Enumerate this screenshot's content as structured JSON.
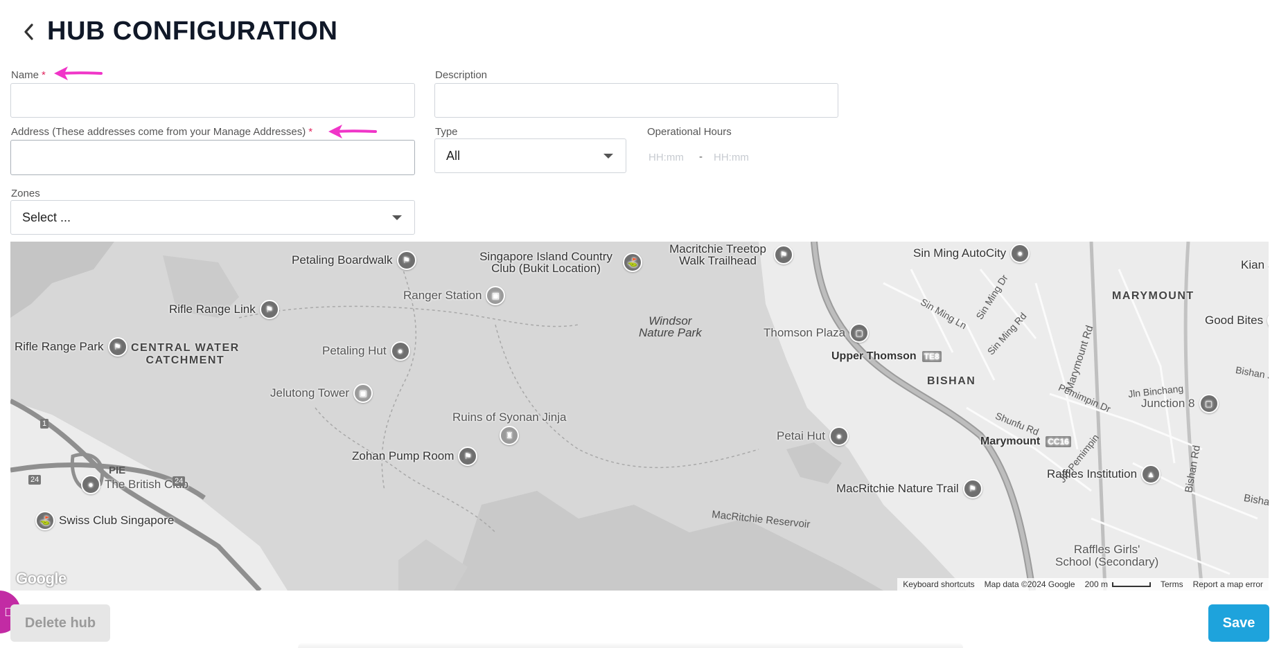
{
  "header": {
    "title": "HUB CONFIGURATION",
    "back_icon": "chevron-left-icon"
  },
  "form": {
    "name": {
      "label": "Name",
      "required_mark": "*",
      "value": ""
    },
    "description": {
      "label": "Description",
      "value": ""
    },
    "address": {
      "label": "Address (These addresses come from your Manage Addresses)",
      "required_mark": "*",
      "value": ""
    },
    "type": {
      "label": "Type",
      "selected": "All"
    },
    "operational_hours": {
      "label": "Operational Hours",
      "start_placeholder": "HH:mm",
      "separator": "-",
      "end_placeholder": "HH:mm"
    },
    "zones": {
      "label": "Zones",
      "selected": "Select ..."
    }
  },
  "annotations": {
    "color": "#f035c8"
  },
  "map": {
    "pois": [
      {
        "name": "Petaling Boardwalk",
        "icon": "hiking-icon"
      },
      {
        "name": "Singapore Island Country Club (Bukit Location)",
        "icon": "golf-icon"
      },
      {
        "name": "Macritchie Treetop Walk Trailhead",
        "icon": "hiking-icon"
      },
      {
        "name": "Sin Ming AutoCity",
        "icon": "pin-icon"
      },
      {
        "name": "Ranger Station",
        "icon": "camera-icon"
      },
      {
        "name": "Rifle Range Link",
        "icon": "hiking-icon"
      },
      {
        "name": "Rifle Range Park",
        "icon": "hiking-icon"
      },
      {
        "name": "Petaling Hut",
        "icon": "pin-icon"
      },
      {
        "name": "Thomson Plaza",
        "icon": "shopping-icon"
      },
      {
        "name": "Jelutong Tower",
        "icon": "camera-icon"
      },
      {
        "name": "Ruins of Syonan Jinja",
        "icon": "landmark-icon"
      },
      {
        "name": "Zohan Pump Room",
        "icon": "hiking-icon"
      },
      {
        "name": "Petai Hut",
        "icon": "pin-icon"
      },
      {
        "name": "The British Club",
        "icon": "pin-icon"
      },
      {
        "name": "Swiss Club Singapore",
        "icon": "golf-icon"
      },
      {
        "name": "MacRitchie Nature Trail",
        "icon": "hiking-icon"
      },
      {
        "name": "Raffles Institution",
        "icon": "school-icon"
      },
      {
        "name": "Junction 8",
        "icon": "shopping-icon"
      },
      {
        "name": "Good Bites",
        "icon": "restaurant-icon"
      }
    ],
    "area_labels": {
      "central": "CENTRAL WATER\nCATCHMENT",
      "marymount": "MARYMOUNT",
      "bishan": "BISHAN",
      "kian": "Kian Se"
    },
    "park_labels": {
      "windsor": "Windsor\nNature Park",
      "reservoir": "MacRitchie Reservoir"
    },
    "stations": {
      "upper_thomson": {
        "name": "Upper Thomson",
        "code": "TE8"
      },
      "marymount": {
        "name": "Marymount",
        "code": "CC16"
      }
    },
    "roads": {
      "sin_ming_ln": "Sin Ming Ln",
      "sin_ming_dr": "Sin Ming Dr",
      "sin_ming_rd": "Sin Ming Rd",
      "marymount_rd": "Marymount Rd",
      "pemimpin_dr": "Pemimpin Dr",
      "jln_binchang": "Jln Binchang",
      "shunfu_rd": "Shunfu Rd",
      "jln_pemimpin": "Jln Pemimpin",
      "bishan_rd": "Bishan Rd",
      "bishan_st": "Bishan St",
      "bisha": "Bisha",
      "pie": "PIE",
      "shield_24a": "24",
      "shield_24b": "24",
      "shield_1": "1"
    },
    "raffles_girls": "Raffles Girls'\nSchool (Secondary)",
    "footer": {
      "keyboard": "Keyboard shortcuts",
      "map_data": "Map data ©2024 Google",
      "scale": "200 m",
      "terms": "Terms",
      "report": "Report a map error"
    },
    "logo": "Google"
  },
  "actions": {
    "delete_label": "Delete hub",
    "save_label": "Save",
    "save_color": "#1ea3dc"
  }
}
